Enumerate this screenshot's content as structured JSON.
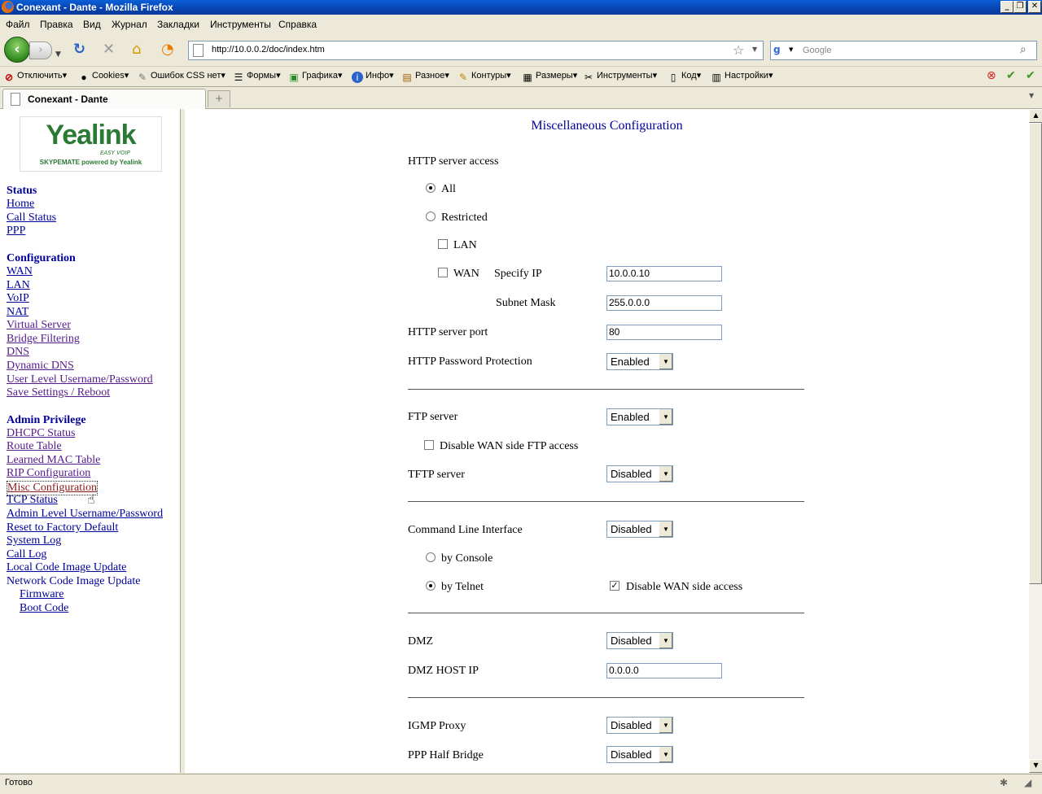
{
  "window": {
    "title": "Conexant - Dante - Mozilla Firefox"
  },
  "menu": [
    "Файл",
    "Правка",
    "Вид",
    "Журнал",
    "Закладки",
    "Инструменты",
    "Справка"
  ],
  "nav": {
    "url": "http://10.0.0.2/doc/index.htm",
    "search_placeholder": "Google"
  },
  "toolbar": [
    "Отключить",
    "Cookies",
    "Ошибок CSS нет",
    "Формы",
    "Графика",
    "Инфо",
    "Разное",
    "Контуры",
    "Размеры",
    "Инструменты",
    "Код",
    "Настройки"
  ],
  "tabs": [
    {
      "label": "Conexant - Dante"
    }
  ],
  "sidebar": {
    "logo": {
      "brand": "Yealink",
      "tagline": "EASY VOIP",
      "sub": "SKYPEMATE powered by Yealink"
    },
    "sections": [
      {
        "title": "Status",
        "items": [
          "Home",
          "Call Status",
          "PPP"
        ]
      },
      {
        "title": "Configuration",
        "items": [
          "WAN",
          "LAN",
          "VoIP",
          "NAT",
          "Virtual Server",
          "Bridge Filtering",
          "DNS",
          "Dynamic DNS",
          "User Level Username/Password",
          "Save Settings / Reboot"
        ]
      },
      {
        "title": "Admin Privilege",
        "items": [
          "DHCPC Status",
          "Route Table",
          "Learned MAC Table",
          "RIP Configuration",
          "Misc Configuration",
          "TCP Status",
          "Admin Level Username/Password",
          "Reset to Factory Default",
          "System Log",
          "Call Log",
          "Local Code Image Update",
          "Network Code Image Update"
        ]
      }
    ],
    "subitems": [
      "Firmware",
      "Boot Code"
    ]
  },
  "main": {
    "title": "Miscellaneous Configuration",
    "http_access": {
      "label": "HTTP server access",
      "all": "All",
      "restricted": "Restricted",
      "lan": "LAN",
      "wan": "WAN",
      "specify_ip": "Specify IP",
      "ip": "10.0.0.10",
      "mask_label": "Subnet Mask",
      "mask": "255.0.0.0"
    },
    "http_port": {
      "label": "HTTP server port",
      "value": "80"
    },
    "http_password": {
      "label": "HTTP Password Protection",
      "value": "Enabled"
    },
    "ftp": {
      "label": "FTP server",
      "value": "Enabled",
      "disable_wan": "Disable WAN side FTP access"
    },
    "tftp": {
      "label": "TFTP server",
      "value": "Disabled"
    },
    "cli": {
      "label": "Command Line Interface",
      "value": "Disabled",
      "by_console": "by Console",
      "by_telnet": "by Telnet",
      "disable_wan": "Disable WAN side access"
    },
    "dmz": {
      "label": "DMZ",
      "value": "Disabled",
      "host_label": "DMZ HOST IP",
      "host": "0.0.0.0"
    },
    "igmp": {
      "label": "IGMP Proxy",
      "value": "Disabled"
    },
    "ppp_half": {
      "label": "PPP Half Bridge",
      "value": "Disabled"
    }
  },
  "status": {
    "text": "Готово"
  }
}
